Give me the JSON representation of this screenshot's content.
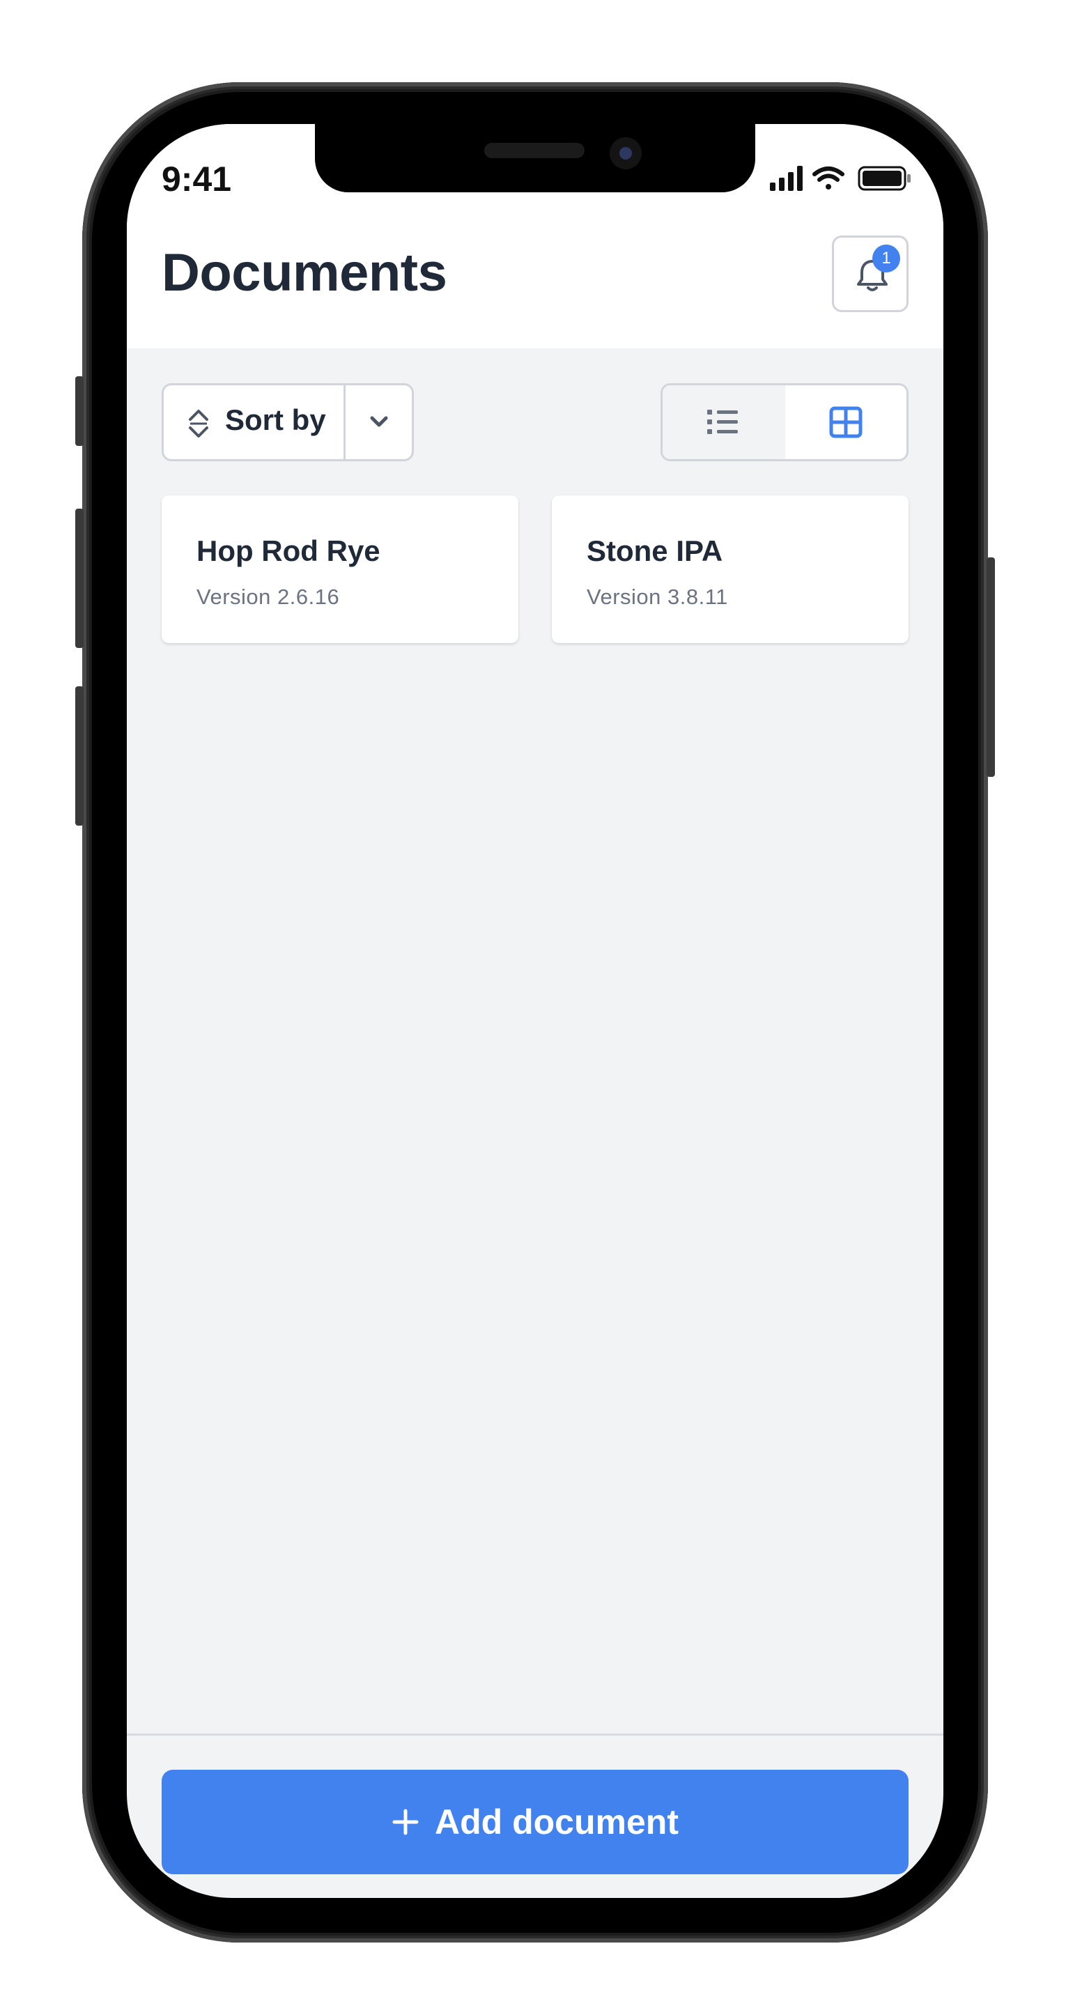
{
  "status_bar": {
    "time": "9:41"
  },
  "header": {
    "title": "Documents",
    "notification_count": "1"
  },
  "toolbar": {
    "sort_label": "Sort by"
  },
  "documents": [
    {
      "title": "Hop Rod Rye",
      "version": "Version 2.6.16"
    },
    {
      "title": "Stone IPA",
      "version": "Version 3.8.11"
    }
  ],
  "footer": {
    "add_label": "Add document"
  },
  "colors": {
    "accent": "#4282ef",
    "title_text": "#1f2937",
    "secondary_text": "#6b7280",
    "background": "#f2f3f5",
    "border": "#d1d5db"
  }
}
